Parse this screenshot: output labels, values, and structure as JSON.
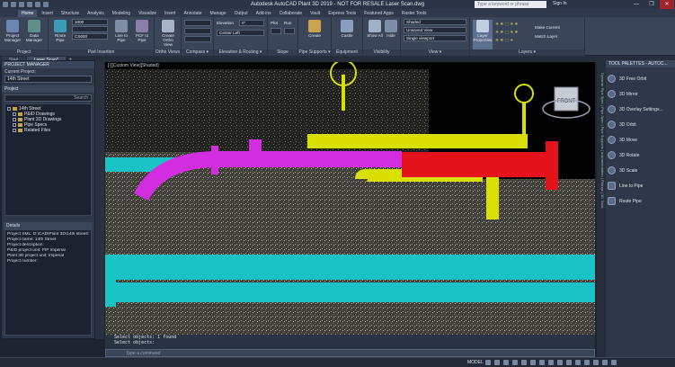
{
  "window": {
    "title": "Autodesk AutoCAD Plant 3D 2019 - NOT FOR RESALE    Laser Scan.dwg",
    "search_placeholder": "Type a keyword or phrase",
    "sign_in": "Sign In",
    "min": "—",
    "max": "❐",
    "close": "✕"
  },
  "tabs": [
    "Home",
    "Insert",
    "Structure",
    "Analysis",
    "Modeling",
    "Visualize",
    "Insert",
    "Annotate",
    "Manage",
    "Output",
    "Add-ins",
    "Collaborate",
    "Vault",
    "Express Tools",
    "Featured Apps",
    "Raster Tools"
  ],
  "ribbon": {
    "project_manager": "Project Manager",
    "data_manager": "Data Manager",
    "route_pipe": "Route Pipe",
    "size_value": "1000",
    "spec_value": "CS600",
    "line_to_pipe": "Line to Pipe",
    "pcf_to_pipe": "PCF to Pipe",
    "create_ortho": "Create Ortho View",
    "elevation_label": "Elevation",
    "elevation_value": "0\"",
    "center_left": "Center Left",
    "plot_label": "Plot",
    "run_label": "Run",
    "create": "Create",
    "castle": "Castle",
    "show_all": "Show All",
    "hide_label": "Hide",
    "visual_style": "Shaded",
    "view_unsaved": "Unsaved View",
    "viewport": "Single viewport",
    "layer_props": "Layer Properties",
    "make_current": "Make Current",
    "match_layer": "Match Layer",
    "panels": [
      "Project",
      "Part Insertion",
      "Ortho Views",
      "Compass ▾",
      "Elevation & Routing ▾",
      "Slope",
      "Pipe Supports ▾",
      "Equipment",
      "Visibility",
      "View ▾",
      "Layers ▾"
    ]
  },
  "doc_tabs": [
    "Start",
    "Laser Scan*"
  ],
  "project_manager": {
    "title": "PROJECT MANAGER",
    "current_project_label": "Current Project:",
    "current_project": "14th Street",
    "project_header": "Project",
    "search": "Search",
    "tree": [
      "14th Street",
      "P&ID Drawings",
      "Plant 3D Drawings",
      "Pipe Specs",
      "Related Files"
    ],
    "details_header": "Details",
    "details": [
      "Project XML: D:\\CAD\\Plant 3D\\14th street\\14",
      "Project name: 14th Street",
      "Project description:",
      "P&ID project unit: PIP Imperial",
      "Plant 3D project unit: Imperial",
      "Project number:"
    ]
  },
  "viewport": {
    "label": "[-][Custom View][Shaded]",
    "viewcube": "FRONT"
  },
  "command": {
    "lines": [
      "Select objects: 1 found",
      "Select objects:"
    ],
    "placeholder": "Type a command"
  },
  "status": {
    "model": "MODEL"
  },
  "tool_palette": {
    "title": "TOOL PALETTES - AUTOC...",
    "tools": [
      "3D Free Orbit",
      "3D Mirror",
      "3D Overlay Settings...",
      "3D Orbit",
      "3D Move",
      "3D Rotate",
      "3D Scale",
      "Line to Pipe",
      "Route Pipe"
    ],
    "side_tabs": "Dynamic Pipe Spec | Pipe Spec | Pipe Supports | Instrumentation | Fittings | 3D Tools"
  },
  "colors": {
    "pipe_cyan": "#19c3c6",
    "pipe_magenta": "#d22de0",
    "pipe_yellow": "#d9e000",
    "pipe_red": "#e3121b"
  }
}
